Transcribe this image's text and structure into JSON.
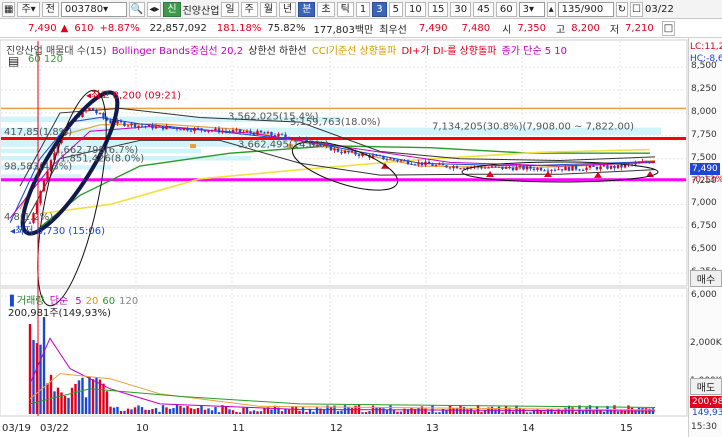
{
  "toolbar": {
    "stock_type": "주",
    "period_type": "전",
    "stock_code": "003780",
    "stock_badge": "신",
    "stock_name": "진양산업",
    "period_buttons": [
      "일",
      "주",
      "월",
      "년",
      "분",
      "초",
      "틱"
    ],
    "interval_buttons": [
      "1",
      "3",
      "5",
      "10",
      "15",
      "30",
      "45",
      "60"
    ],
    "interval_value": "3",
    "count": "135/900",
    "date": "03/22"
  },
  "quote": {
    "price": "7,490",
    "change": "610",
    "rate": "+8.87%",
    "volume": "22,857,092",
    "vol_ratio": "181.18%",
    "turnover": "75.82%",
    "amount": "177,803백만",
    "best_ask_label": "최우선",
    "best_ask": "7,490",
    "best_bid": "7,480",
    "open_label": "시",
    "open": "7,350",
    "high_label": "고",
    "high": "8,200",
    "low_label": "저",
    "low": "7,210"
  },
  "legend": {
    "title": "진양산업 매물대 수(15)",
    "bollinger": "Bollinger Bands중심선 20,2",
    "upper_lower": "상한선  하한선",
    "cci": "CCI기준선 상향돌파",
    "dmi": "DI+가 DI-를 상향돌파",
    "ma_label": "종가 단순 5  10",
    "ma_sub": "60  120",
    "lc": "LC:11,2",
    "hc": "HC:-8,6"
  },
  "annotations": {
    "high_mark": "최고 8,200 (09:21)",
    "low_mark": "최저 6,730 (15:06)",
    "vp1": "3,562,025(15.4%)",
    "vp2": "5,159,763(18.0%)",
    "vp3": "7,134,205(30.8%)(7,908.00 ~ 7,822.00)",
    "vp4": "3,662,495(14.8%)",
    "vp5": "1,662,798(6.7%)",
    "vp6": "1,851,426(8.0%)",
    "vp_left1": "417,85(1.8%)",
    "vp_left2": "98,583(4.3%)",
    "vp_left3": "4,8(1.2%)"
  },
  "price_axis": {
    "ticks": [
      "8,500",
      "8,250",
      "8,000",
      "7,750",
      "7,500",
      "7,250",
      "7,000",
      "6,750",
      "6,500",
      "6,250",
      "6,000"
    ],
    "current": "7,490",
    "pct": "-0.13%"
  },
  "volume_panel": {
    "title": "거래량",
    "ma": "단순",
    "ma_values": [
      "5",
      "20",
      "60",
      "120"
    ],
    "max_label": "200,981주(149,93%)",
    "axis_ticks": [
      "2,000K",
      "1,000K"
    ],
    "tag_value": "200,98",
    "tag_pct": "149,93"
  },
  "time_axis": {
    "labels": [
      "03/19",
      "03/22",
      "10",
      "11",
      "12",
      "13",
      "14",
      "15"
    ],
    "right": "15:30"
  },
  "side_buttons": [
    "매수",
    "매도"
  ],
  "colors": {
    "up": "#e0001b",
    "down": "#1a48d2",
    "resistance": "#ff0000",
    "support": "#ff00ff",
    "volume_profile": "#c9f2fa"
  },
  "chart_data": {
    "type": "candlestick",
    "ylim": [
      6000,
      8600
    ],
    "current_price": 7490,
    "open": 7350,
    "high": 8200,
    "low": 7210,
    "previous_close": 6880,
    "volume_max": 2000000
  }
}
